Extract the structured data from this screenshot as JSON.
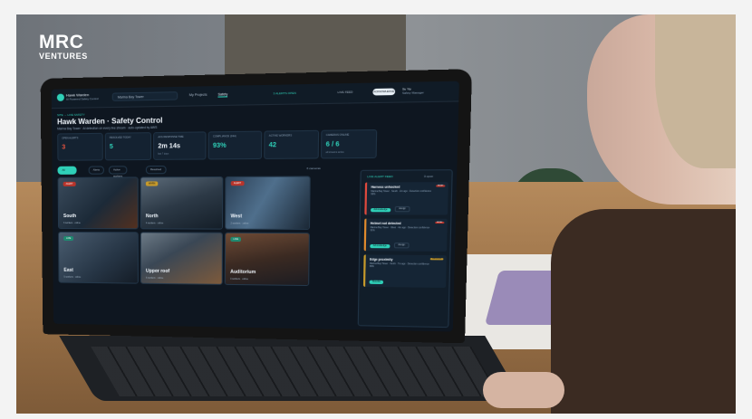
{
  "watermark": {
    "line1": "MRC",
    "line2": "VENTURES"
  },
  "app": {
    "brand": {
      "name": "Hawk Warden",
      "tagline": "AI Powered Safety Control"
    },
    "site_selector": "Marina Bay Tower",
    "nav": [
      "My Projects",
      "Safety"
    ],
    "header_status_1": "3 ALERTS OPEN",
    "header_status_2": "LIVE FEED",
    "header_button": "ACKNOWLEDGE",
    "user": {
      "name": "Su Yip",
      "role": "Safety Manager"
    },
    "breadcrumb": "SITE → LIVE SAFETY",
    "page_title": "Hawk Warden · Safety Control",
    "page_subtitle": "Marina Bay Tower · AI detection on every live stream · auto-updated by AWS",
    "kpis": [
      {
        "label": "OPEN ALERTS",
        "value": "3",
        "note": "",
        "color": "#e5533f"
      },
      {
        "label": "RESOLVED TODAY",
        "value": "5",
        "note": "",
        "color": "#2fd0b8"
      },
      {
        "label": "AVG RESPONSE TIME",
        "value": "2m 14s",
        "note": "last 7 days",
        "color": "#f0f6fc"
      },
      {
        "label": "COMPLIANCE (24H)",
        "value": "93%",
        "note": "",
        "color": "#2fd0b8"
      },
      {
        "label": "ACTIVE WORKERS",
        "value": "42",
        "note": "",
        "color": "#2fd0b8"
      },
      {
        "label": "CAMERAS ONLINE",
        "value": "6 / 6",
        "note": "all streams active",
        "color": "#2fd0b8"
      }
    ],
    "filters": [
      "All cameras",
      "Alerts",
      "Active workers",
      "Resolved"
    ],
    "cameras_count": "6 cameras",
    "cameras": [
      {
        "name": "South",
        "meta": "3 workers · online",
        "tag": "ALERT",
        "tag_color": "#b8342b"
      },
      {
        "name": "North",
        "meta": "4 workers · online",
        "tag": "WARN",
        "tag_color": "#c79a2a"
      },
      {
        "name": "West",
        "meta": "2 workers · online",
        "tag": "ALERT",
        "tag_color": "#b8342b"
      },
      {
        "name": "East",
        "meta": "5 workers · online",
        "tag": "LIVE",
        "tag_color": "#1f8a70"
      },
      {
        "name": "Upper roof",
        "meta": "6 workers · online",
        "tag": "",
        "tag_color": "#1f8a70"
      },
      {
        "name": "Auditorium",
        "meta": "3 workers · online",
        "tag": "LIVE",
        "tag_color": "#1f8a70"
      }
    ],
    "alert_panel": {
      "title": "LIVE ALERT FEED",
      "count": "3 open",
      "alerts": [
        {
          "title": "Harness unhooked",
          "desc": "Marina Bay Tower · South · 2m ago · Detection confidence 96%",
          "sev": "HIGH",
          "btn": "Acknowledge",
          "btn2": "Assign"
        },
        {
          "title": "Helmet not detected",
          "desc": "Marina Bay Tower · West · 4m ago · Detection confidence 91%",
          "sev": "HIGH",
          "btn": "Acknowledge",
          "btn2": "Assign"
        },
        {
          "title": "Edge proximity",
          "desc": "Marina Bay Tower · North · 7m ago · Detection confidence 88%",
          "sev": "MEDIUM",
          "btn": "Resolve",
          "btn2": ""
        }
      ]
    }
  }
}
